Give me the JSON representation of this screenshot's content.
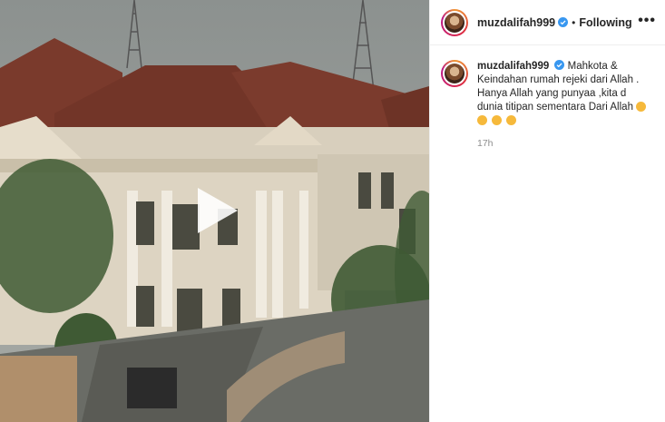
{
  "post": {
    "username": "muzdalifah999",
    "follow_status": "Following",
    "separator": "•",
    "more_label": "•••",
    "caption": "Mahkota & Keindahan rumah rejeki dari Allah . Hanya Allah yang punyaa ,kita d dunia titipan sementara Dari Allah",
    "timestamp": "17h",
    "icons": [
      "verified-badge-icon",
      "play-icon",
      "more-options-icon",
      "emoji-icon"
    ]
  },
  "colors": {
    "verified": "#3897f0",
    "muted": "#8e8e8e",
    "text": "#262626"
  }
}
